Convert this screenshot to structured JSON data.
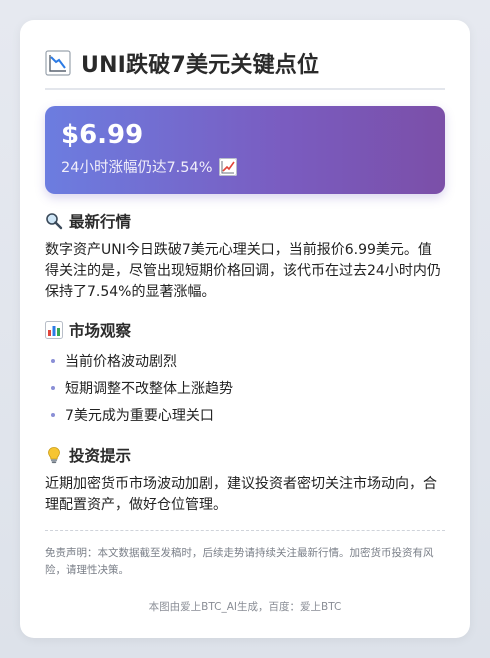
{
  "header": {
    "title": "UNI跌破7美元关键点位",
    "title_icon": "chart-decreasing-icon"
  },
  "price_box": {
    "price": "$6.99",
    "change_text": "24小时涨幅仍达7.54%",
    "change_icon": "chart-increasing-icon",
    "gradient_start": "#6c7de0",
    "gradient_end": "#7b4fa8"
  },
  "sections": {
    "market": {
      "icon": "magnifier-icon",
      "title": "最新行情",
      "body": "数字资产UNI今日跌破7美元心理关口，当前报价6.99美元。值得关注的是，尽管出现短期价格回调，该代币在过去24小时内仍保持了7.54%的显著涨幅。"
    },
    "observation": {
      "icon": "bar-chart-icon",
      "title": "市场观察",
      "items": [
        "当前价格波动剧烈",
        "短期调整不改整体上涨趋势",
        "7美元成为重要心理关口"
      ]
    },
    "tips": {
      "icon": "lightbulb-icon",
      "title": "投资提示",
      "body": "近期加密货币市场波动加剧，建议投资者密切关注市场动向，合理配置资产，做好仓位管理。"
    }
  },
  "disclaimer": "免责声明：本文数据截至发稿时，后续走势请持续关注最新行情。加密货币投资有风险，请理性决策。",
  "footer": "本图由爱上BTC_AI生成，百度：爱上BTC"
}
